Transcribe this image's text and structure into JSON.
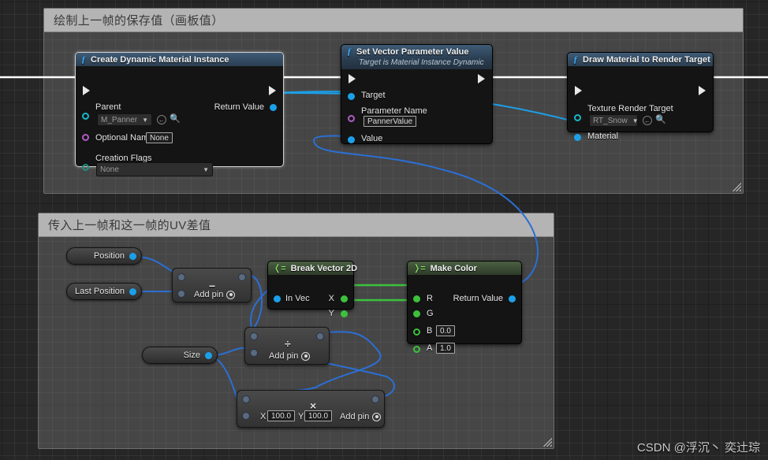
{
  "app": {
    "editor": "blueprint-graph",
    "watermark": "CSDN @浮沉丶 奕辻琮"
  },
  "comments": [
    {
      "title": "绘制上一帧的保存值（画板值）"
    },
    {
      "title": "传入上一帧和这一帧的UV差值"
    }
  ],
  "nodes": {
    "create_dynamic_material_instance": {
      "title": "Create Dynamic Material Instance",
      "icon": "function-f-icon",
      "inputs": {
        "parent_label": "Parent",
        "parent_value": "M_Panner",
        "optional_name_label": "Optional Name",
        "optional_name_value": "None",
        "creation_flags_label": "Creation Flags",
        "creation_flags_value": "None"
      },
      "outputs": {
        "return_value_label": "Return Value"
      }
    },
    "set_vector_parameter_value": {
      "title": "Set Vector Parameter Value",
      "subtitle": "Target is Material Instance Dynamic",
      "icon": "function-f-icon",
      "inputs": {
        "target_label": "Target",
        "parameter_name_label": "Parameter Name",
        "parameter_name_value": "PannerValue",
        "value_label": "Value"
      }
    },
    "draw_material_to_render_target": {
      "title": "Draw Material to Render Target",
      "icon": "function-f-icon",
      "inputs": {
        "texture_render_target_label": "Texture Render Target",
        "texture_render_target_value": "RT_Snow",
        "material_label": "Material"
      }
    },
    "position_var": {
      "label": "Position"
    },
    "last_position_var": {
      "label": "Last Position"
    },
    "size_var": {
      "label": "Size"
    },
    "subtract_node": {
      "symbol": "−",
      "add_pin_label": "Add pin"
    },
    "divide_node": {
      "symbol": "÷",
      "add_pin_label": "Add pin"
    },
    "multiply_node": {
      "symbol": "×",
      "add_pin_label": "Add pin",
      "x_label": "X",
      "x_value": "100.0",
      "y_label": "Y",
      "y_value": "100.0"
    },
    "break_vector_2d": {
      "title": "Break Vector 2D",
      "icon": "break-struct-icon",
      "inputs": {
        "in_vec_label": "In Vec"
      },
      "outputs": {
        "x_label": "X",
        "y_label": "Y"
      }
    },
    "make_color": {
      "title": "Make Color",
      "icon": "make-struct-icon",
      "inputs": {
        "r_label": "R",
        "g_label": "G",
        "b_label": "B",
        "b_value": "0.0",
        "a_label": "A",
        "a_value": "1.0"
      },
      "outputs": {
        "return_value_label": "Return Value"
      }
    }
  },
  "colors": {
    "exec_wire": "#ffffff",
    "object_wire": "#1ba0e8",
    "float_wire": "#3cc13c",
    "struct_wire": "#2b6fd4",
    "node_title_fn": "#3f5b76",
    "node_title_pure": "#4a5f42",
    "canvas_bg": "#262626"
  }
}
